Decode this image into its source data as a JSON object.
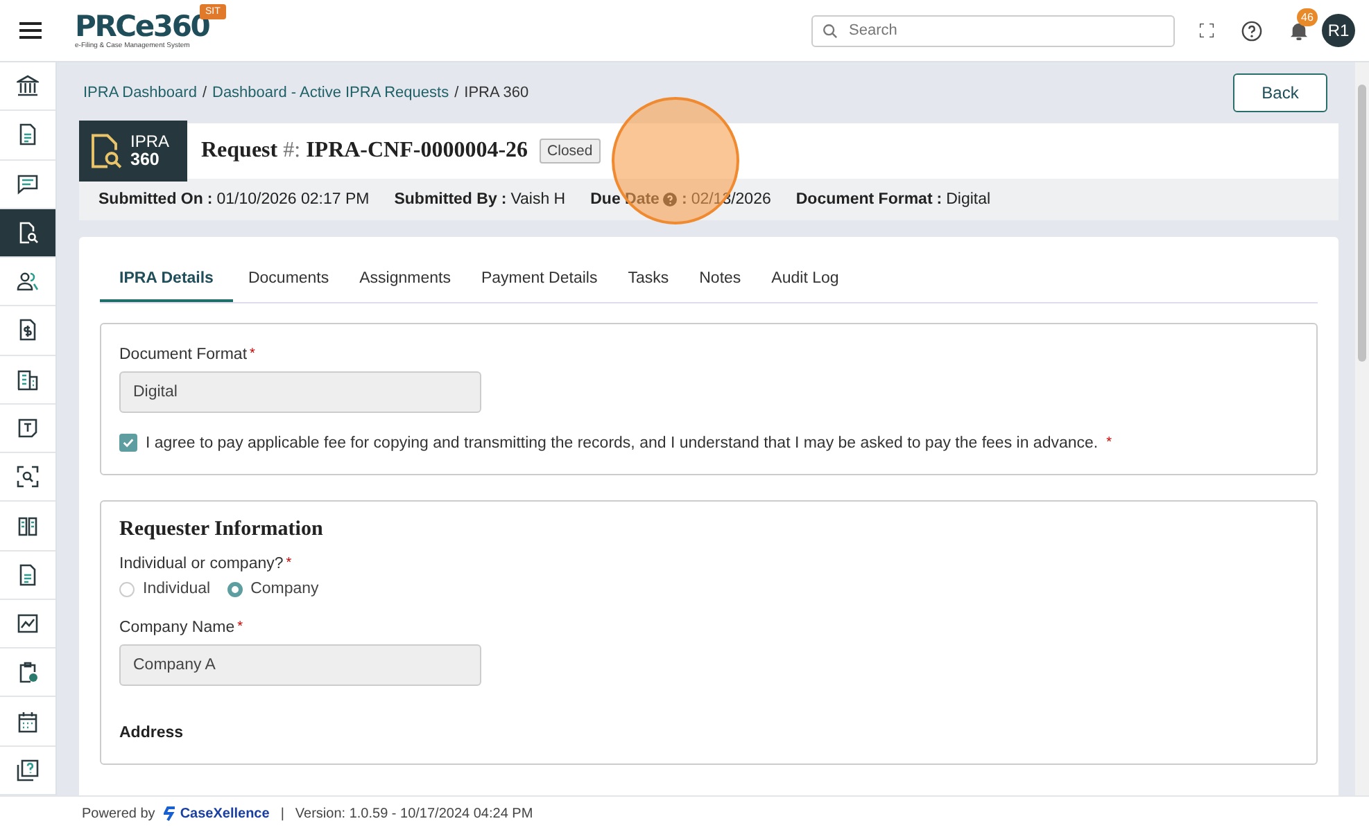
{
  "header": {
    "logo": "PRCe360",
    "logo_tagline": "e-Filing & Case Management System",
    "env_badge": "SIT",
    "search": {
      "placeholder": "Search"
    },
    "notification_count": "46",
    "avatar": "R1"
  },
  "sidebar": {
    "items": [
      {
        "selected": false
      },
      {
        "selected": false
      },
      {
        "selected": false
      },
      {
        "selected": true
      },
      {
        "selected": false
      },
      {
        "selected": false
      },
      {
        "selected": false
      },
      {
        "selected": false
      },
      {
        "selected": false
      },
      {
        "selected": false
      },
      {
        "selected": false
      },
      {
        "selected": false
      },
      {
        "selected": false
      },
      {
        "selected": false
      },
      {
        "selected": false
      }
    ]
  },
  "breadcrumb": [
    {
      "label": "IPRA Dashboard",
      "link": true
    },
    {
      "separator": "/",
      "label": "Dashboard - Active IPRA Requests",
      "link": true
    },
    {
      "separator": "/",
      "label": "IPRA 360",
      "link": false
    }
  ],
  "back_button": "Back",
  "request": {
    "module_name": "IPRA",
    "module_number": "360",
    "title_label": "Request",
    "title_hash": "#:",
    "number": "IPRA-CNF-0000004-26",
    "status": "Closed"
  },
  "summary": [
    {
      "label": "Submitted On",
      "separator": ":",
      "help": false,
      "value": "01/10/2026 02:17 PM"
    },
    {
      "label": "Submitted By",
      "separator": ":",
      "help": false,
      "value": "Vaish H"
    },
    {
      "label": "Due Date",
      "separator": ":",
      "help": true,
      "value": "02/13/2026"
    },
    {
      "label": "Document Format",
      "separator": ":",
      "help": false,
      "value": "Digital"
    }
  ],
  "tabs": [
    {
      "label": "IPRA Details",
      "selected": true
    },
    {
      "label": "Documents",
      "selected": false
    },
    {
      "label": "Assignments",
      "selected": false
    },
    {
      "label": "Payment Details",
      "selected": false
    },
    {
      "label": "Tasks",
      "selected": false
    },
    {
      "label": "Notes",
      "selected": false
    },
    {
      "label": "Audit Log",
      "selected": false
    }
  ],
  "document_format": {
    "label": "Document Format",
    "required_mark": "*",
    "value": "Digital"
  },
  "agreement": {
    "checked": true,
    "text": "I agree to pay applicable fee for copying and transmitting the records, and I understand that I may be asked to pay the fees in advance.",
    "required_mark": "*"
  },
  "requester": {
    "heading": "Requester Information",
    "type_question": {
      "label": "Individual or company?",
      "required_mark": "*",
      "options": [
        {
          "label": "Individual",
          "selected": false
        },
        {
          "label": "Company",
          "selected": true
        }
      ]
    },
    "company_name": {
      "label": "Company Name",
      "required_mark": "*",
      "value": "Company A"
    },
    "address_heading": "Address"
  },
  "footer": {
    "powered_by": "Powered by",
    "brand": "CaseXellence",
    "separator": "|",
    "version": "Version: 1.0.59 - 10/17/2024 04:24 PM"
  }
}
